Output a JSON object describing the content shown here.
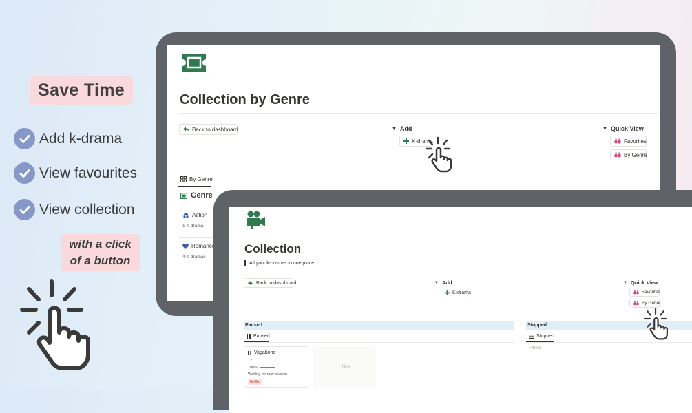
{
  "promo": {
    "headline": "Save Time",
    "features": [
      "Add k-drama",
      "View favourites",
      "View collection"
    ],
    "click_note_line1": "with a click",
    "click_note_line2": "of a button"
  },
  "genre_page": {
    "title": "Collection by Genre",
    "back_button": "Back to dashboard",
    "add_header": "Add",
    "add_button": "K-drama",
    "quick_view_header": "Quick View",
    "favorites_button": "Favorites",
    "by_genre_button": "By Genre",
    "view_tab": "By Genre",
    "group_header": "Genre",
    "cards": [
      {
        "title": "Action",
        "subtitle": "1 K-drama"
      },
      {
        "title": "Romance",
        "subtitle": "4 K-dramas"
      }
    ]
  },
  "collection_page": {
    "title": "Collection",
    "subtitle": "All your k-dramas in one place",
    "back_button": "Back to dashboard",
    "add_header": "Add",
    "add_button": "K-drama",
    "quick_view_header": "Quick View",
    "favorites_button": "Favorites",
    "by_genre_button": "By Genre",
    "paused_group": "Paused",
    "paused_tab": "Paused",
    "stopped_group": "Stopped",
    "stopped_tab": "Stopped",
    "new_label": "New",
    "new_link": "+ New",
    "card": {
      "title": "Vagabond",
      "episodes": "12",
      "progress_label": "100%",
      "progress": 1.0,
      "note": "Waiting for new season",
      "tag": "Netflix"
    }
  },
  "colors": {
    "accent_green": "#2f7a4f",
    "check_blue": "#8698c8",
    "promo_pink": "#f9d9dc",
    "device_gray": "#5f6367",
    "group_header_blue": "#e1edf7",
    "tag_red": "#e9514f"
  },
  "icons": {
    "check": "check-circle-icon",
    "ticket": "ticket-icon",
    "camera": "movie-camera-icon",
    "back": "back-arrow-icon",
    "plus": "plus-icon",
    "binoculars": "binoculars-icon",
    "grid": "grid-icon",
    "pointer": "hand-pointer-icon"
  }
}
